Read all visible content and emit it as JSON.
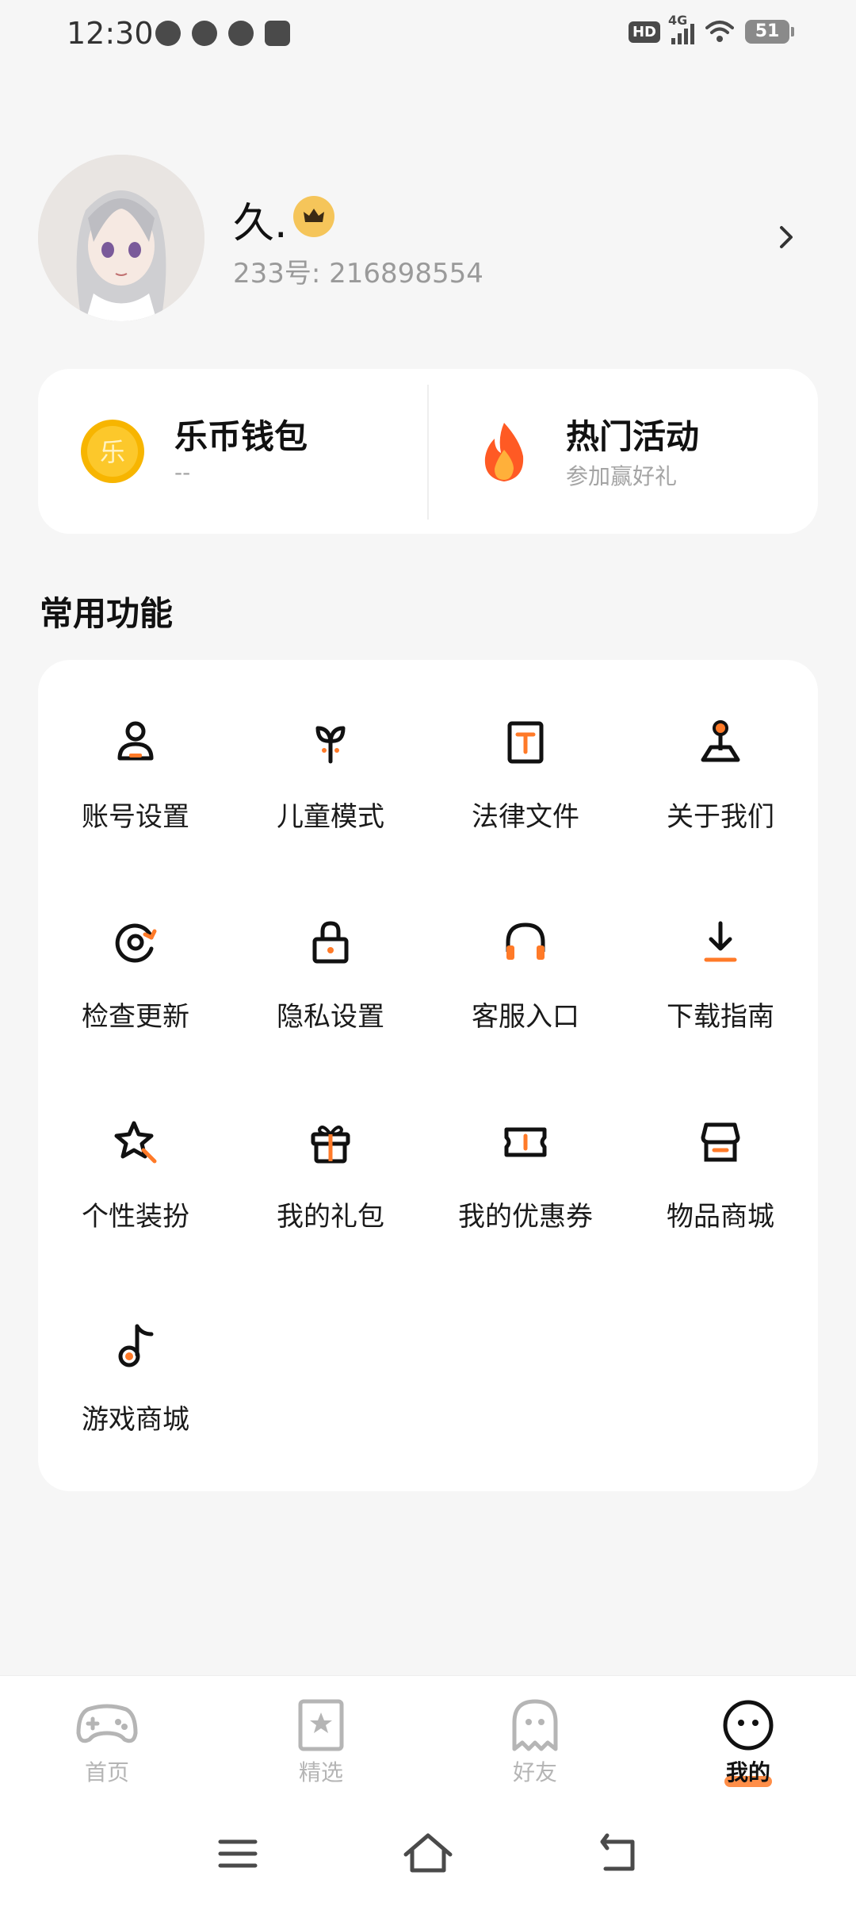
{
  "status_bar": {
    "time": "12:30",
    "network": "4G",
    "hd": "HD",
    "battery": "51",
    "app_icons": [
      "clock-icon",
      "wechat-icon",
      "message-icon",
      "play-icon"
    ]
  },
  "profile": {
    "name": "久.",
    "id_text": "233号: 216898554",
    "vip_icon": "crown-icon"
  },
  "quick": {
    "wallet": {
      "title": "乐币钱包",
      "sub": "--",
      "icon_text": "乐"
    },
    "activity": {
      "title": "热门活动",
      "sub": "参加赢好礼"
    }
  },
  "section": {
    "title": "常用功能"
  },
  "functions": [
    {
      "label": "账号设置",
      "icon": "account-icon"
    },
    {
      "label": "儿童模式",
      "icon": "sprout-icon"
    },
    {
      "label": "法律文件",
      "icon": "document-icon"
    },
    {
      "label": "关于我们",
      "icon": "joystick-icon"
    },
    {
      "label": "检查更新",
      "icon": "update-icon"
    },
    {
      "label": "隐私设置",
      "icon": "lock-icon"
    },
    {
      "label": "客服入口",
      "icon": "headset-icon"
    },
    {
      "label": "下载指南",
      "icon": "download-icon"
    },
    {
      "label": "个性装扮",
      "icon": "star-wand-icon"
    },
    {
      "label": "我的礼包",
      "icon": "gift-icon"
    },
    {
      "label": "我的优惠券",
      "icon": "coupon-icon"
    },
    {
      "label": "物品商城",
      "icon": "store-icon"
    },
    {
      "label": "游戏商城",
      "icon": "music-note-icon"
    }
  ],
  "nav": [
    {
      "label": "首页",
      "icon": "gamepad-icon"
    },
    {
      "label": "精选",
      "icon": "star-bookmark-icon"
    },
    {
      "label": "好友",
      "icon": "ghost-icon"
    },
    {
      "label": "我的",
      "icon": "smiley-icon",
      "active": true
    }
  ],
  "colors": {
    "accent": "#ff7a28",
    "text": "#1a1a1a",
    "muted": "#9a9a9a",
    "card": "#ffffff",
    "background": "#f6f6f6"
  }
}
